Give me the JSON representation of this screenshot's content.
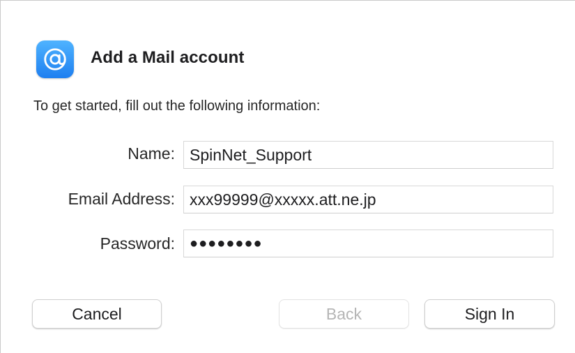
{
  "dialog": {
    "title": "Add a Mail account",
    "intro": "To get started, fill out the following information:",
    "icon": "at-sign-icon",
    "accent_color": "#1e7ff0"
  },
  "form": {
    "name": {
      "label": "Name:",
      "value": "SpinNet_Support"
    },
    "email": {
      "label": "Email Address:",
      "value": "xxx99999@xxxxx.att.ne.jp"
    },
    "password": {
      "label": "Password:",
      "value": "●●●●●●●●"
    }
  },
  "buttons": {
    "cancel": "Cancel",
    "back": "Back",
    "sign_in": "Sign In"
  }
}
